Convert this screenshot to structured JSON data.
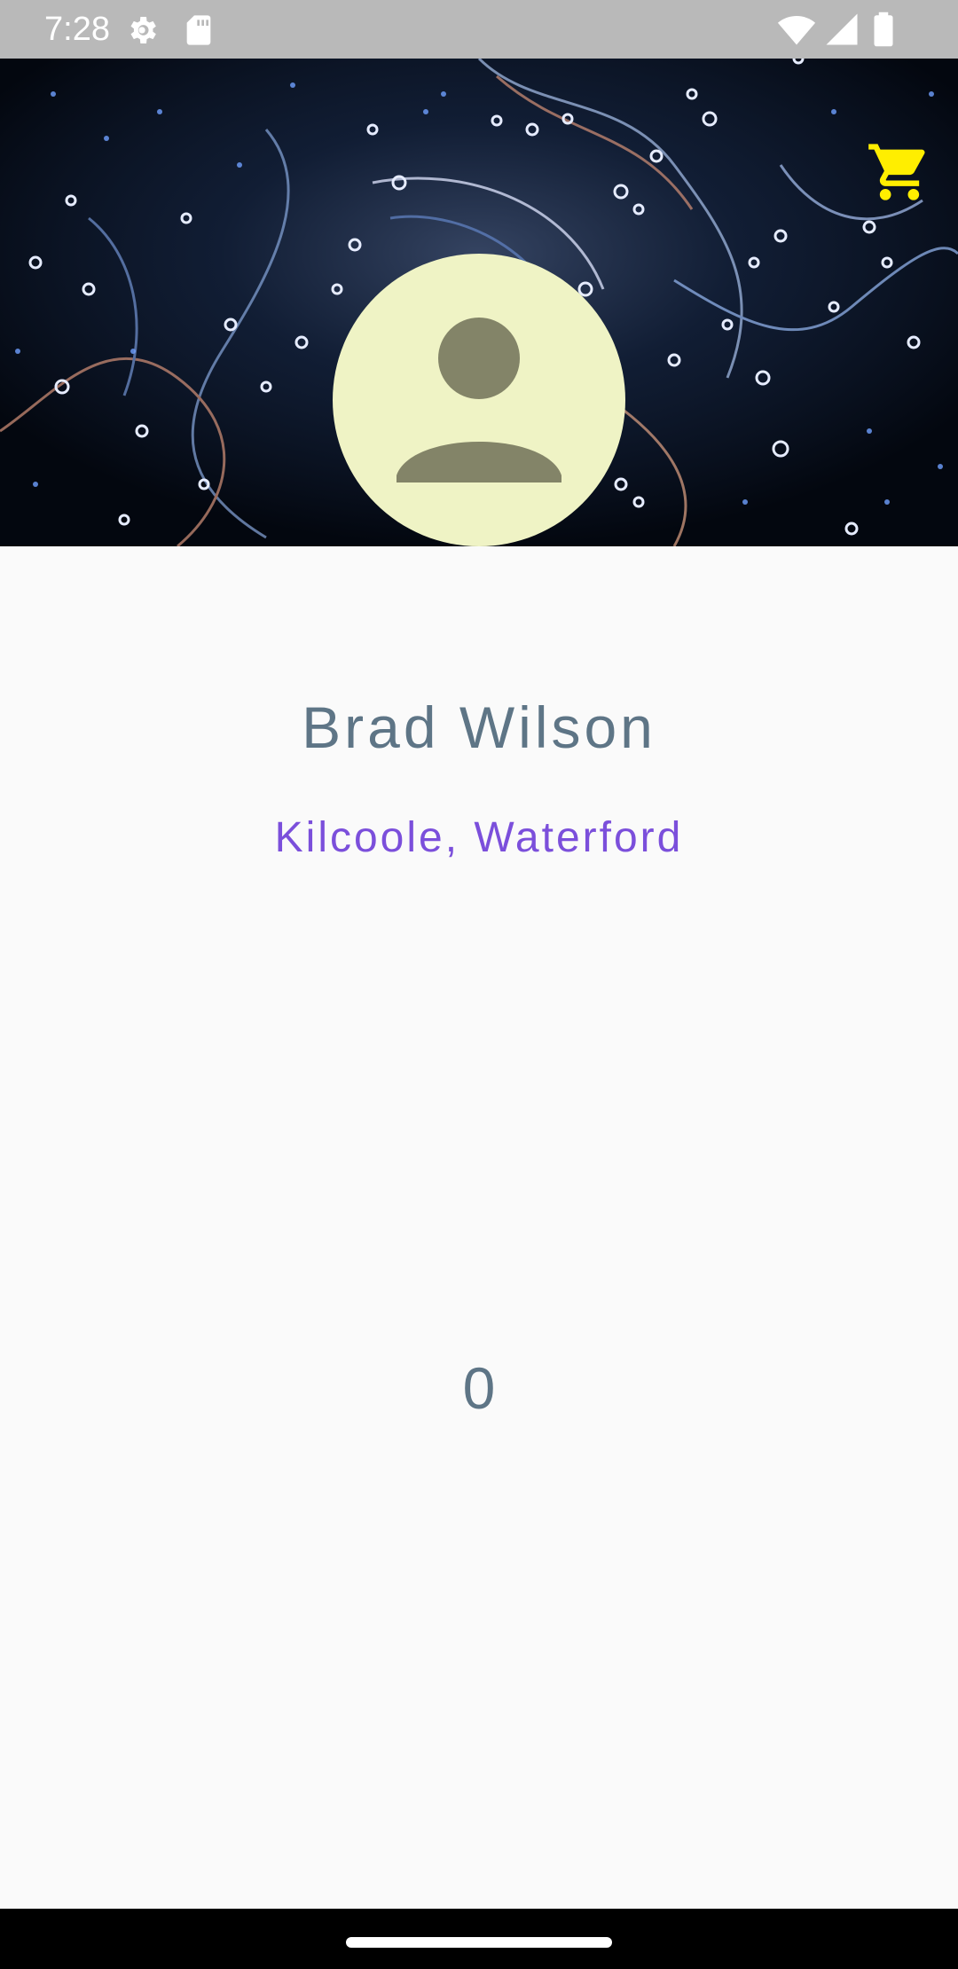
{
  "status_bar": {
    "time": "7:28",
    "icons": [
      "settings-gear-icon",
      "sd-card-icon",
      "wifi-icon",
      "cellular-signal-icon",
      "battery-icon"
    ]
  },
  "header": {
    "background": "particle-art-image",
    "cart_icon": "shopping-cart-icon",
    "cart_color": "#ffee00"
  },
  "profile": {
    "avatar_icon": "person-placeholder-icon",
    "name": "Brad Wilson",
    "location": "Kilcoole, Waterford",
    "count": "0"
  },
  "colors": {
    "name_text": "#5e7586",
    "location_text": "#7b4fdb",
    "avatar_bg": "#eff3c5",
    "avatar_figure": "#838468"
  }
}
